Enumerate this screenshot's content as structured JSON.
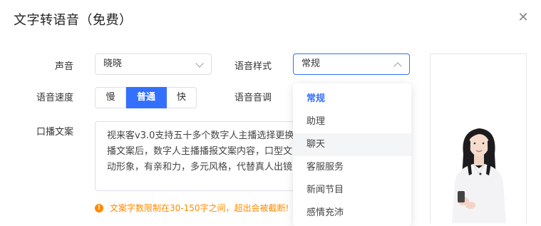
{
  "dialog": {
    "title": "文字转语音（免费）",
    "close_icon": "close-icon"
  },
  "form": {
    "voice": {
      "label": "声音",
      "value": "晓晓"
    },
    "style": {
      "label": "语音样式",
      "value": "常规"
    },
    "speed": {
      "label": "语音速度",
      "options": [
        "慢",
        "普通",
        "快"
      ],
      "selected": "普通"
    },
    "pitch": {
      "label": "语音音调"
    },
    "script": {
      "label": "口播文案",
      "lines": [
        "视来客v3.0支持五十多个数字人主播选择更换，输入",
        "播文案后，数字人主播播报文案内容，口型文",
        "动形象，有亲和力，多元风格，代替真人出镜"
      ]
    },
    "warning": "文案字数限制在30-150字之间，超出会被截断!"
  },
  "style_dropdown": {
    "options": [
      "常规",
      "助理",
      "聊天",
      "客服服务",
      "新闻节目",
      "感情充沛"
    ],
    "selected": "常规",
    "hovered": "聊天"
  },
  "colors": {
    "accent": "#3370ff",
    "warning": "#ff8a00",
    "border": "#dcdfe6"
  }
}
